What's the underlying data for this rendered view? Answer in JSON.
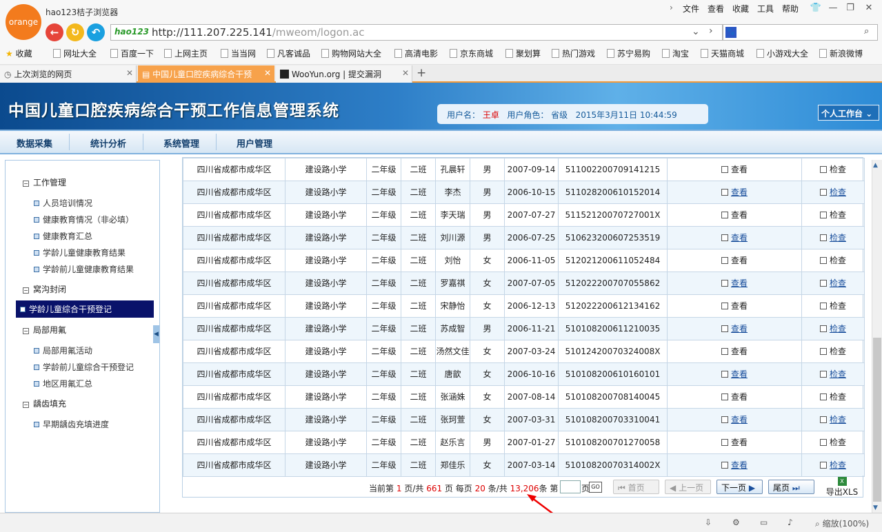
{
  "browser": {
    "logo_label": "orange",
    "title": "hao123桔子浏览器",
    "menu": [
      "文件",
      "查看",
      "收藏",
      "工具",
      "帮助"
    ],
    "address_logo": "hao123",
    "url_host": "http://111.207.225.141",
    "url_path": "/mweom/logon.ac",
    "favorites": [
      "收藏",
      "网址大全",
      "百度一下",
      "上网主页",
      "当当网",
      "凡客诚品",
      "购物网站大全",
      "高清电影",
      "京东商城",
      "聚划算",
      "热门游戏",
      "苏宁易购",
      "淘宝",
      "天猫商城",
      "小游戏大全",
      "新浪微博"
    ],
    "tabs": [
      {
        "label": "上次浏览的网页"
      },
      {
        "label": "中国儿童口腔疾病综合干预"
      },
      {
        "label": "WooYun.org | 提交漏洞"
      }
    ],
    "tab_add": "+",
    "status_zoom": "缩放(100%)"
  },
  "app": {
    "title": "中国儿童口腔疾病综合干预工作信息管理系统",
    "user_label": "用户名：",
    "user_name": "王卓",
    "role_label": "用户角色：",
    "role": "省级",
    "datetime": "2015年3月11日  10:44:59",
    "workbench": "个人工作台",
    "nav": [
      "数据采集",
      "统计分析",
      "系统管理",
      "用户管理"
    ]
  },
  "sidebar": {
    "groups": [
      {
        "title": "工作管理",
        "items": [
          "人员培训情况",
          "健康教育情况（非必填）",
          "健康教育汇总",
          "学龄儿童健康教育结果",
          "学龄前儿童健康教育结果"
        ]
      },
      {
        "title": "窝沟封闭",
        "items": [
          "学龄儿童综合干预登记"
        ]
      },
      {
        "title": "局部用氟",
        "items": [
          "局部用氟活动",
          "学龄前儿童综合干预登记",
          "地区用氟汇总"
        ]
      },
      {
        "title": "龋齿填充",
        "items": [
          "早期龋齿充填进度"
        ]
      }
    ],
    "active_item": "学龄儿童综合干预登记"
  },
  "table": {
    "view_label": "查看",
    "check_label": "检查",
    "rows": [
      {
        "region": "四川省成都市成华区",
        "school": "建设路小学",
        "grade": "二年级",
        "class": "二班",
        "name": "孔晨轩",
        "sex": "男",
        "birth": "2007-09-14",
        "id": "511002200709141215"
      },
      {
        "region": "四川省成都市成华区",
        "school": "建设路小学",
        "grade": "二年级",
        "class": "二班",
        "name": "李杰",
        "sex": "男",
        "birth": "2006-10-15",
        "id": "511028200610152014"
      },
      {
        "region": "四川省成都市成华区",
        "school": "建设路小学",
        "grade": "二年级",
        "class": "二班",
        "name": "李天瑞",
        "sex": "男",
        "birth": "2007-07-27",
        "id": "51152120070727001X"
      },
      {
        "region": "四川省成都市成华区",
        "school": "建设路小学",
        "grade": "二年级",
        "class": "二班",
        "name": "刘川源",
        "sex": "男",
        "birth": "2006-07-25",
        "id": "510623200607253519"
      },
      {
        "region": "四川省成都市成华区",
        "school": "建设路小学",
        "grade": "二年级",
        "class": "二班",
        "name": "刘怡",
        "sex": "女",
        "birth": "2006-11-05",
        "id": "512021200611052484"
      },
      {
        "region": "四川省成都市成华区",
        "school": "建设路小学",
        "grade": "二年级",
        "class": "二班",
        "name": "罗嘉祺",
        "sex": "女",
        "birth": "2007-07-05",
        "id": "512022200707055862"
      },
      {
        "region": "四川省成都市成华区",
        "school": "建设路小学",
        "grade": "二年级",
        "class": "二班",
        "name": "宋静怡",
        "sex": "女",
        "birth": "2006-12-13",
        "id": "512022200612134162"
      },
      {
        "region": "四川省成都市成华区",
        "school": "建设路小学",
        "grade": "二年级",
        "class": "二班",
        "name": "苏成智",
        "sex": "男",
        "birth": "2006-11-21",
        "id": "510108200611210035"
      },
      {
        "region": "四川省成都市成华区",
        "school": "建设路小学",
        "grade": "二年级",
        "class": "二班",
        "name": "汤然文佳",
        "sex": "女",
        "birth": "2007-03-24",
        "id": "51012420070324008X"
      },
      {
        "region": "四川省成都市成华区",
        "school": "建设路小学",
        "grade": "二年级",
        "class": "二班",
        "name": "唐歆",
        "sex": "女",
        "birth": "2006-10-16",
        "id": "510108200610160101"
      },
      {
        "region": "四川省成都市成华区",
        "school": "建设路小学",
        "grade": "二年级",
        "class": "二班",
        "name": "张涵姝",
        "sex": "女",
        "birth": "2007-08-14",
        "id": "510108200708140045"
      },
      {
        "region": "四川省成都市成华区",
        "school": "建设路小学",
        "grade": "二年级",
        "class": "二班",
        "name": "张珂萱",
        "sex": "女",
        "birth": "2007-03-31",
        "id": "510108200703310041"
      },
      {
        "region": "四川省成都市成华区",
        "school": "建设路小学",
        "grade": "二年级",
        "class": "二班",
        "name": "赵乐言",
        "sex": "男",
        "birth": "2007-01-27",
        "id": "510108200701270058"
      },
      {
        "region": "四川省成都市成华区",
        "school": "建设路小学",
        "grade": "二年级",
        "class": "二班",
        "name": "郑佳乐",
        "sex": "女",
        "birth": "2007-03-14",
        "id": "51010820070314002X"
      }
    ]
  },
  "pager": {
    "t1": "当前第",
    "current": "1",
    "t2": "页/共",
    "pages": "661",
    "t3": "页 每页",
    "per_page": "20",
    "t4": "条/共",
    "total": "13,206",
    "t5": "条 第",
    "t6": "页",
    "go": "GO",
    "first": "首页",
    "prev": "上一页",
    "next": "下一页",
    "last": "尾页",
    "export": "导出XLS"
  }
}
